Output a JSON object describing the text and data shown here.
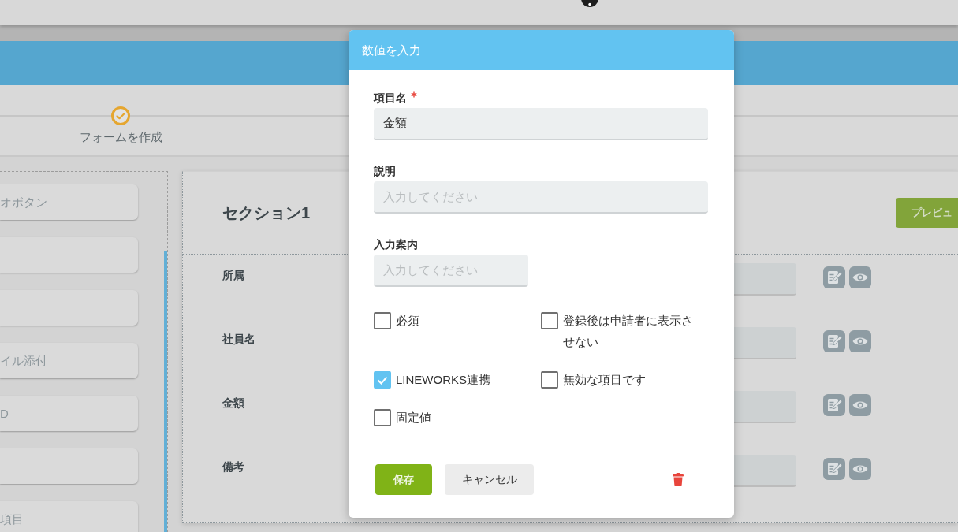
{
  "steps": [
    {
      "label": "フォームを作成",
      "completed": true
    }
  ],
  "palette": [
    {
      "kind": "labeled",
      "label": "オボタン"
    },
    {
      "kind": "blank"
    },
    {
      "kind": "blank"
    },
    {
      "kind": "labeled",
      "label": "イル添付"
    },
    {
      "kind": "labeled",
      "label": "D"
    },
    {
      "kind": "blank"
    },
    {
      "kind": "labeled",
      "label": "項目"
    }
  ],
  "section": {
    "title": "セクション1",
    "preview_button": "プレビュ",
    "rows": [
      {
        "label": "所属"
      },
      {
        "label": "社員名"
      },
      {
        "label": "金額"
      },
      {
        "label": "備考"
      }
    ]
  },
  "dialog": {
    "title": "数値を入力",
    "fields": [
      {
        "label": "項目名",
        "required": true,
        "value": "金額"
      },
      {
        "label": "説明",
        "required": false,
        "placeholder": "入力してください"
      },
      {
        "label": "入力案内",
        "required": false,
        "placeholder": "入力してください"
      }
    ],
    "options": [
      {
        "label": "必須",
        "checked": false
      },
      {
        "label": "登録後は申請者に表示させない",
        "checked": false
      },
      {
        "label": "LINEWORKS連携",
        "checked": true
      },
      {
        "label": "無効な項目です",
        "checked": false
      },
      {
        "label": "固定値",
        "checked": false
      }
    ],
    "save_button": "保存",
    "cancel_button": "キャンセル"
  }
}
